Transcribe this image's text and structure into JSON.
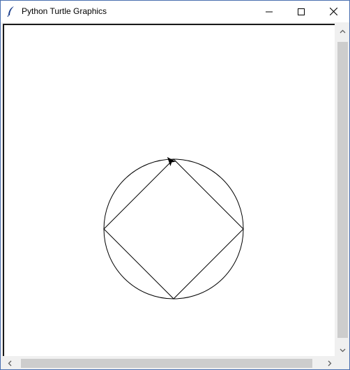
{
  "window": {
    "title": "Python Turtle Graphics",
    "app_icon": "feather-icon",
    "controls": {
      "minimize_icon": "minimize-icon",
      "maximize_icon": "maximize-icon",
      "close_icon": "close-icon"
    }
  },
  "canvas": {
    "background": "#ffffff",
    "pen_color": "#000000",
    "shapes": [
      "circle",
      "square",
      "turtle-arrow"
    ],
    "turtle_icon": "turtle-arrow-icon"
  },
  "scrollbars": {
    "vertical": {
      "up_icon": "chevron-up-icon",
      "down_icon": "chevron-down-icon"
    },
    "horizontal": {
      "left_icon": "chevron-left-icon",
      "right_icon": "chevron-right-icon"
    },
    "thumb_color": "#cdcdcd"
  }
}
